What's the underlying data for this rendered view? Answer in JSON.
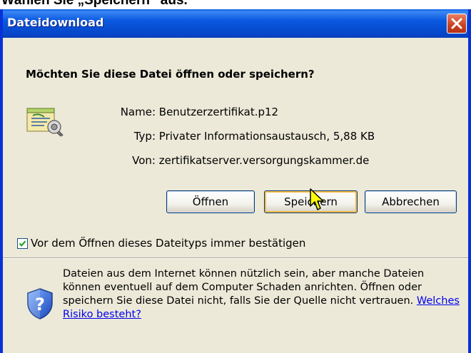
{
  "background_caption": "Wählen Sie „Speichern“ aus.",
  "dialog": {
    "title": "Dateidownload",
    "question": "Möchten Sie diese Datei öffnen oder speichern?",
    "file_info": {
      "name_label": "Name:",
      "name_value": "Benutzerzertifikat.p12",
      "type_label": "Typ:",
      "type_value": "Privater Informationsaustausch, 5,88 KB",
      "from_label": "Von:",
      "from_value": "zertifikatserver.versorgungskammer.de"
    },
    "buttons": {
      "open": "Öffnen",
      "save": "Speichern",
      "cancel": "Abbrechen"
    },
    "checkbox": {
      "label": "Vor dem Öffnen dieses Dateityps immer bestätigen",
      "checked": true
    },
    "warning": {
      "text": "Dateien aus dem Internet können nützlich sein, aber manche Dateien können eventuell auf dem Computer Schaden anrichten. Öffnen oder speichern Sie diese Datei nicht, falls Sie der Quelle nicht vertrauen.",
      "link": "Welches Risiko besteht?"
    }
  },
  "icons": {
    "file": "certificate-file-icon",
    "shield": "security-shield-icon",
    "close": "close-icon",
    "cursor": "mouse-pointer-icon"
  },
  "colors": {
    "titlebar": "#0a58df",
    "dialog_bg": "#ece9d8",
    "close_button": "#c8421f",
    "focus_ring": "#f7ba46",
    "link": "#0000ee"
  }
}
